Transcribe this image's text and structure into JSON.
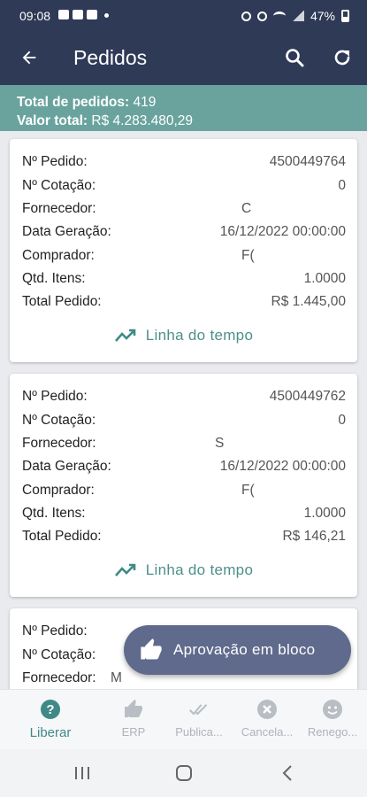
{
  "status_bar": {
    "time": "09:08",
    "battery": "47%"
  },
  "app_bar": {
    "title": "Pedidos"
  },
  "summary": {
    "total_label": "Total de pedidos:",
    "total_value": "419",
    "value_label": "Valor total:",
    "value_value": "R$ 4.283.480,29"
  },
  "labels": {
    "pedido": "Nº Pedido:",
    "cotacao": "Nº Cotação:",
    "fornecedor": "Fornecedor:",
    "data": "Data Geração:",
    "comprador": "Comprador:",
    "qtd": "Qtd. Itens:",
    "total": "Total Pedido:",
    "timeline": "Linha do tempo"
  },
  "orders": [
    {
      "pedido": "4500449764",
      "cotacao": "0",
      "fornecedor": "C",
      "data": "16/12/2022 00:00:00",
      "comprador": "F(",
      "qtd": "1.0000",
      "total": "R$ 1.445,00"
    },
    {
      "pedido": "4500449762",
      "cotacao": "0",
      "fornecedor": "S",
      "data": "16/12/2022 00:00:00",
      "comprador": "F(",
      "qtd": "1.0000",
      "total": "R$ 146,21"
    },
    {
      "fornecedor": "M"
    }
  ],
  "fab": {
    "label": "Aprovação em bloco"
  },
  "bottom_nav": [
    {
      "label": "Liberar",
      "icon": "help-circle-icon"
    },
    {
      "label": "ERP",
      "icon": "thumbs-up-icon"
    },
    {
      "label": "Publica...",
      "icon": "double-check-icon"
    },
    {
      "label": "Cancela...",
      "icon": "close-circle-icon"
    },
    {
      "label": "Renego...",
      "icon": "smiley-icon"
    }
  ],
  "colors": {
    "app_bar": "#2f3a57",
    "summary": "#6aa39e",
    "accent": "#3f8a86",
    "fab": "#5f6a8c"
  }
}
